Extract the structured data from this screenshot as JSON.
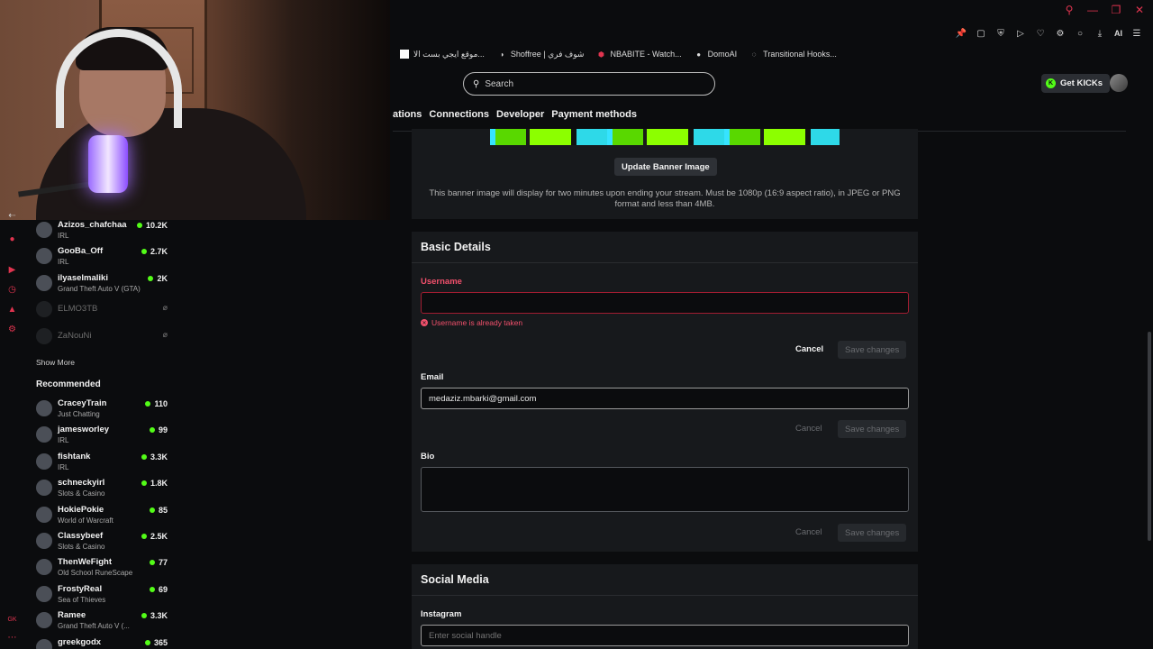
{
  "browser": {
    "bookmarks": [
      {
        "label": "موقع ايجي بست الا...",
        "icon": "white-square-icon"
      },
      {
        "label": "Shoffree | شوف فري",
        "icon": "shoffree-icon"
      },
      {
        "label": "NBABITE - Watch...",
        "icon": "nba-icon"
      },
      {
        "label": "DomoAI",
        "icon": "domoai-icon"
      },
      {
        "label": "Transitional Hooks...",
        "icon": "loading-icon"
      }
    ],
    "toolbar_ai": "AI"
  },
  "nav": {
    "search_placeholder": "Search",
    "get_kicks_label": "Get KICKs",
    "settings_tabs": [
      "ations",
      "Connections",
      "Developer",
      "Payment methods"
    ]
  },
  "sidebar": {
    "following": [
      {
        "name": "Azizos_chafchaa",
        "category": "IRL",
        "viewers": "10.2K",
        "live": true
      },
      {
        "name": "GooBa_Off",
        "category": "IRL",
        "viewers": "2.7K",
        "live": true
      },
      {
        "name": "ilyaselmaliki",
        "category": "Grand Theft Auto V (GTA)",
        "viewers": "2K",
        "live": true
      },
      {
        "name": "ELMO3TB",
        "category": "",
        "viewers": "",
        "live": false
      },
      {
        "name": "ZaNouNi",
        "category": "",
        "viewers": "",
        "live": false
      }
    ],
    "show_more": "Show More",
    "recommended_title": "Recommended",
    "recommended": [
      {
        "name": "CraceyTrain",
        "category": "Just Chatting",
        "viewers": "110"
      },
      {
        "name": "jamesworley",
        "category": "IRL",
        "viewers": "99"
      },
      {
        "name": "fishtank",
        "category": "IRL",
        "viewers": "3.3K"
      },
      {
        "name": "schneckyirl",
        "category": "Slots & Casino",
        "viewers": "1.8K"
      },
      {
        "name": "HokiePokie",
        "category": "World of Warcraft",
        "viewers": "85"
      },
      {
        "name": "Classybeef",
        "category": "Slots & Casino",
        "viewers": "2.5K"
      },
      {
        "name": "ThenWeFight",
        "category": "Old School RuneScape",
        "viewers": "77"
      },
      {
        "name": "FrostyReal",
        "category": "Sea of Thieves",
        "viewers": "69"
      },
      {
        "name": "Ramee",
        "category": "Grand Theft Auto V (...",
        "viewers": "3.3K"
      },
      {
        "name": "greekgodx",
        "category": "",
        "viewers": "365"
      }
    ]
  },
  "banner": {
    "update_label": "Update Banner Image",
    "note": "This banner image will display for two minutes upon ending your stream. Must be 1080p (16:9 aspect ratio), in JPEG or PNG format and less than 4MB."
  },
  "basic_details": {
    "title": "Basic Details",
    "username_label": "Username",
    "username_value": "",
    "username_error": "Username is already taken",
    "email_label": "Email",
    "email_value": "medaziz.mbarki@gmail.com",
    "bio_label": "Bio",
    "bio_value": "",
    "cancel_label": "Cancel",
    "save_label": "Save changes"
  },
  "social_media": {
    "title": "Social Media",
    "instagram_label": "Instagram",
    "instagram_placeholder": "Enter social handle"
  },
  "colors": {
    "kick_green": "#53fc18",
    "error_red": "#f2506c",
    "panel_bg": "#17191c"
  }
}
